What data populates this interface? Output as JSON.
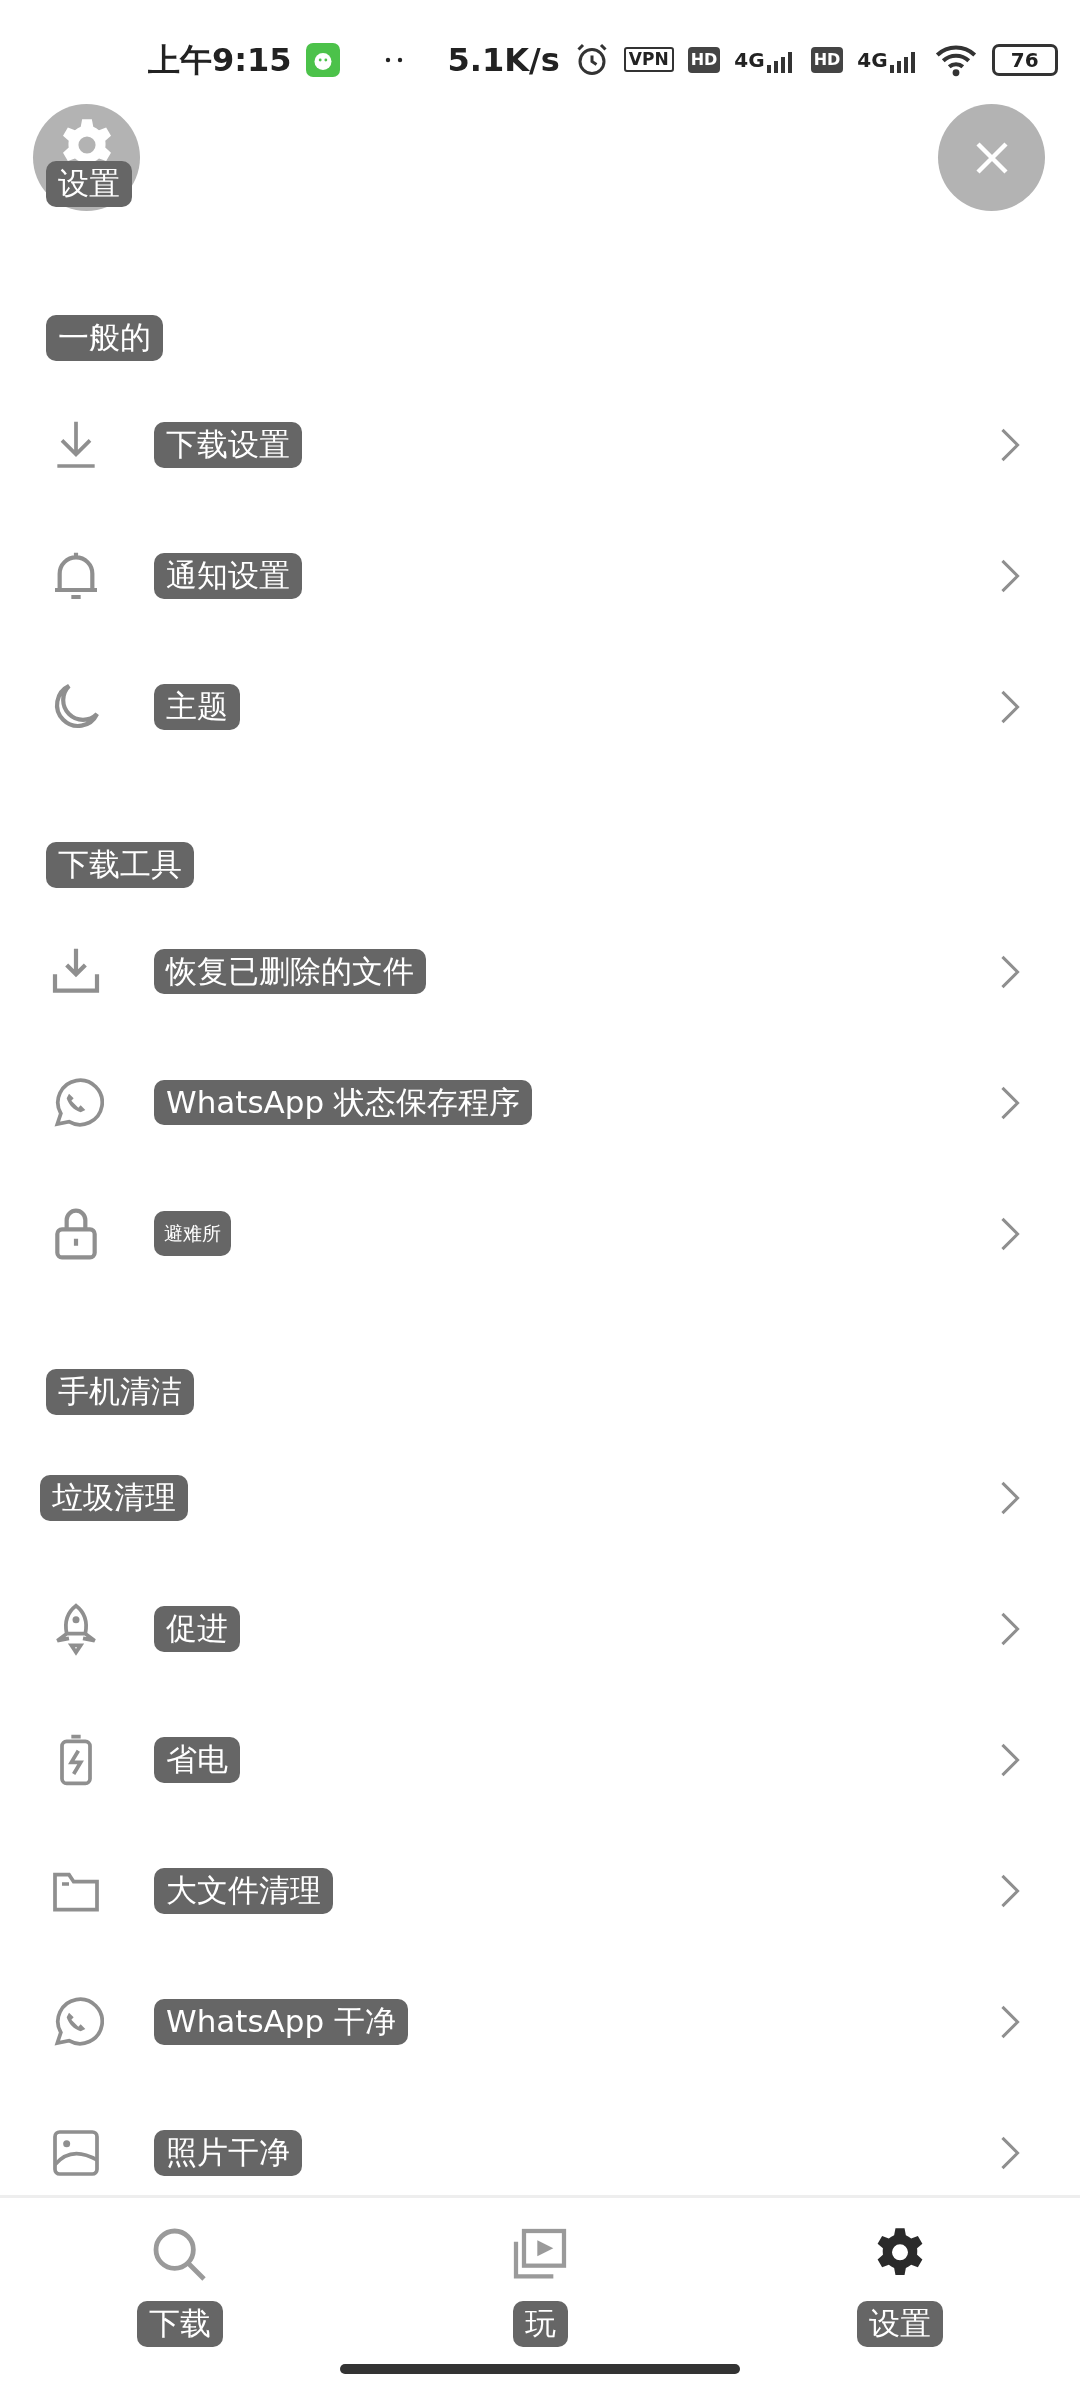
{
  "status_bar": {
    "time": "上午9:15",
    "speed": "5.1K/s",
    "vpn": "VPN",
    "sim1_hd": "HD",
    "sim1_network": "4G",
    "sim2_hd": "HD",
    "sim2_network": "4G",
    "battery": "76"
  },
  "header": {
    "title": "设置"
  },
  "sections": [
    {
      "title": "一般的",
      "items": [
        {
          "label": "下载设置"
        },
        {
          "label": "通知设置"
        },
        {
          "label": "主题"
        }
      ]
    },
    {
      "title": "下载工具",
      "items": [
        {
          "label": "恢复已删除的文件"
        },
        {
          "label": "WhatsApp 状态保存程序"
        },
        {
          "label": "避难所",
          "kind": "small"
        }
      ]
    },
    {
      "title": "手机清洁",
      "items": [
        {
          "label": "垃圾清理",
          "kind": "wide"
        },
        {
          "label": "促进"
        },
        {
          "label": "省电"
        },
        {
          "label": "大文件清理"
        },
        {
          "label": "WhatsApp 干净"
        },
        {
          "label": "照片干净"
        }
      ]
    }
  ],
  "bottom_nav": [
    {
      "label": "下载",
      "selected": false
    },
    {
      "label": "玩",
      "selected": false
    },
    {
      "label": "设置",
      "selected": true
    }
  ]
}
